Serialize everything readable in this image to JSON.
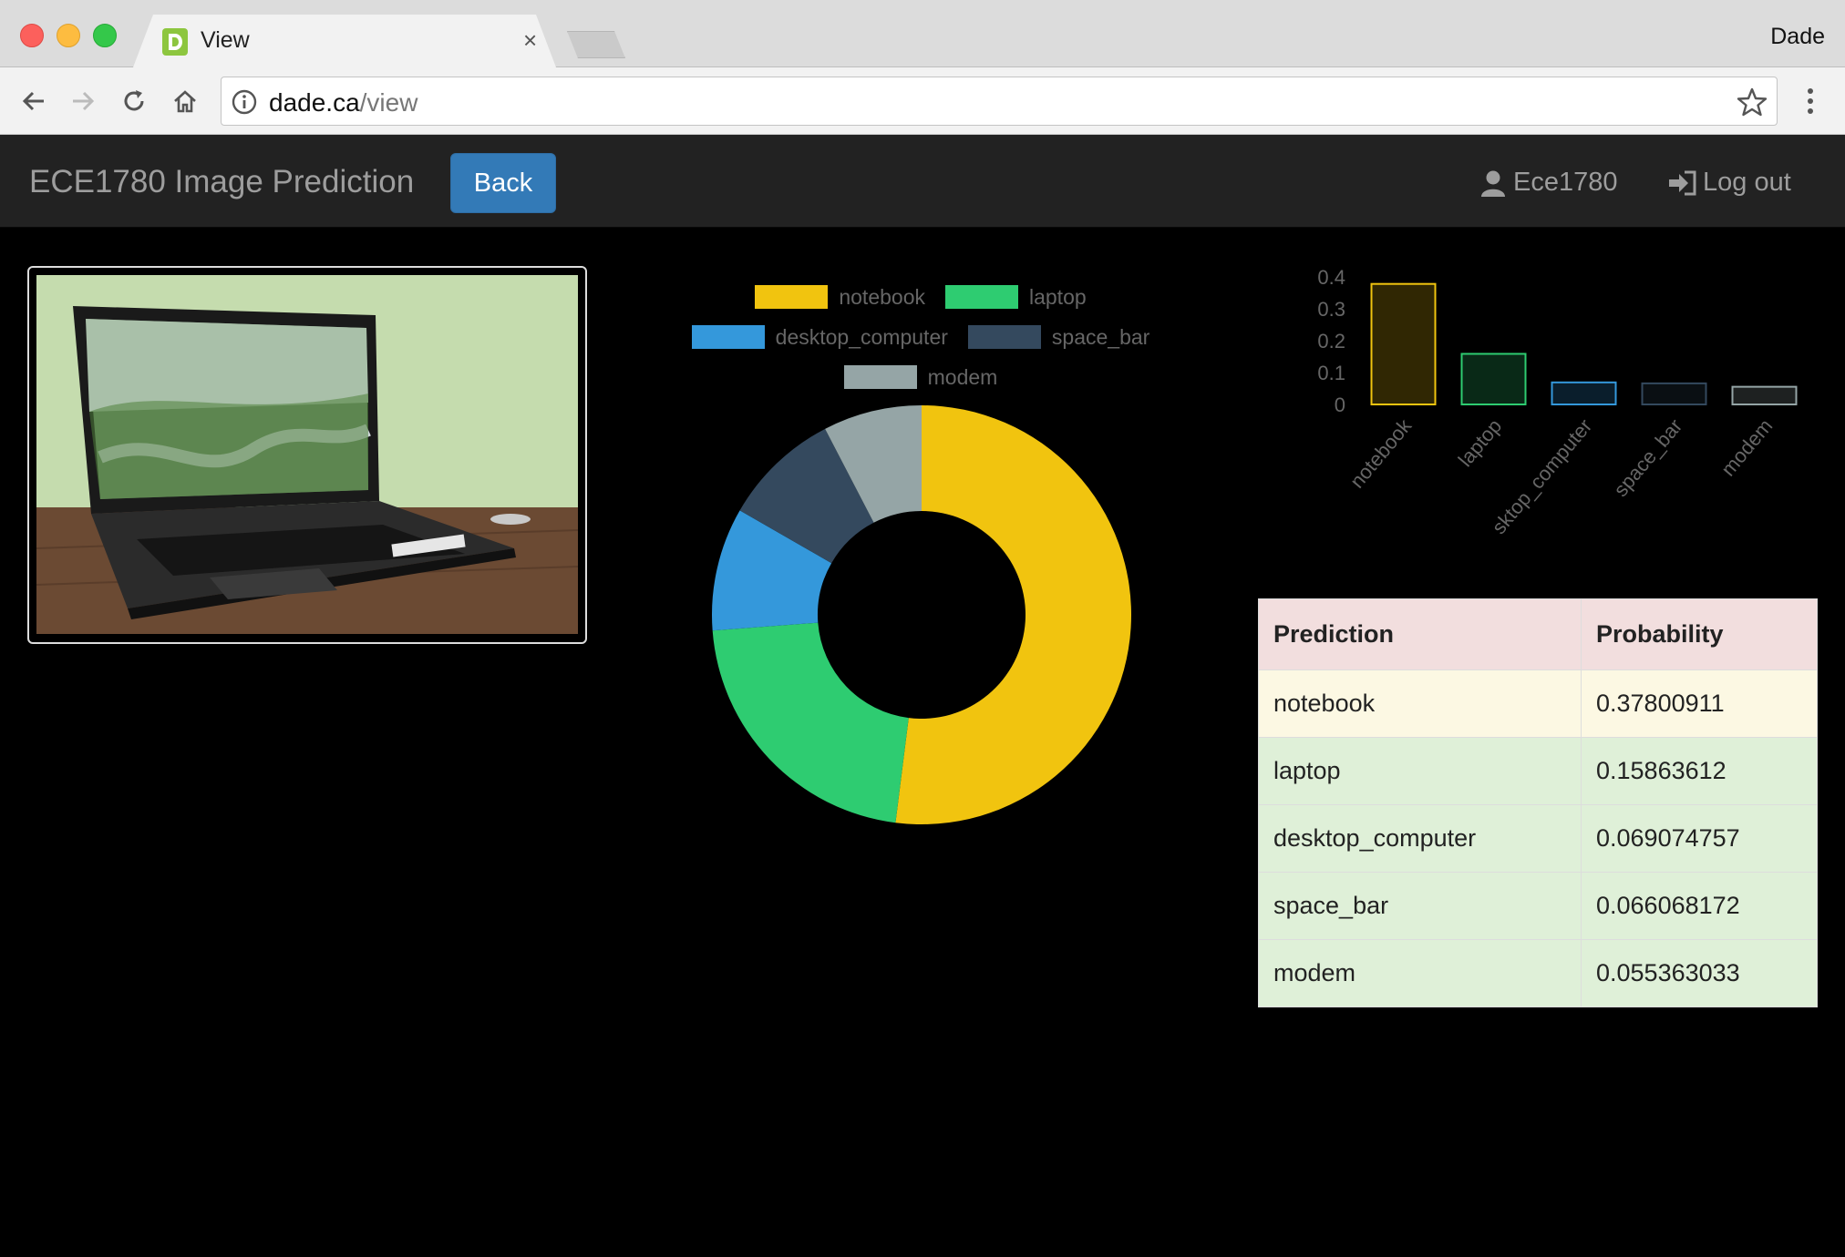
{
  "browser": {
    "tab_title": "View",
    "tab_close": "×",
    "profile_name": "Dade",
    "url_host": "dade.ca",
    "url_path": "/view"
  },
  "navbar": {
    "brand": "ECE1780 Image Prediction",
    "back_label": "Back",
    "user_label": "Ece1780",
    "logout_label": "Log out"
  },
  "colors": {
    "notebook": "#f1c40f",
    "laptop": "#2ecc71",
    "desktop_computer": "#3498db",
    "space_bar": "#34495e",
    "modem": "#95a5a6",
    "primary": "#337ab7"
  },
  "chart_data": [
    {
      "type": "pie",
      "categories": [
        "notebook",
        "laptop",
        "desktop_computer",
        "space_bar",
        "modem"
      ],
      "values": [
        0.37800911,
        0.15863612,
        0.069074757,
        0.066068172,
        0.055363033
      ],
      "legend": [
        "notebook",
        "laptop",
        "desktop_computer",
        "space_bar",
        "modem"
      ]
    },
    {
      "type": "bar",
      "categories": [
        "notebook",
        "laptop",
        "sktop_computer",
        "space_bar",
        "modem"
      ],
      "values": [
        0.37800911,
        0.15863612,
        0.069074757,
        0.066068172,
        0.055363033
      ],
      "yticks": [
        "0",
        "0.1",
        "0.2",
        "0.3",
        "0.4"
      ],
      "ylim": [
        0,
        0.4
      ]
    }
  ],
  "table": {
    "headers": [
      "Prediction",
      "Probability"
    ],
    "rows": [
      [
        "notebook",
        "0.37800911"
      ],
      [
        "laptop",
        "0.15863612"
      ],
      [
        "desktop_computer",
        "0.069074757"
      ],
      [
        "space_bar",
        "0.066068172"
      ],
      [
        "modem",
        "0.055363033"
      ]
    ]
  }
}
